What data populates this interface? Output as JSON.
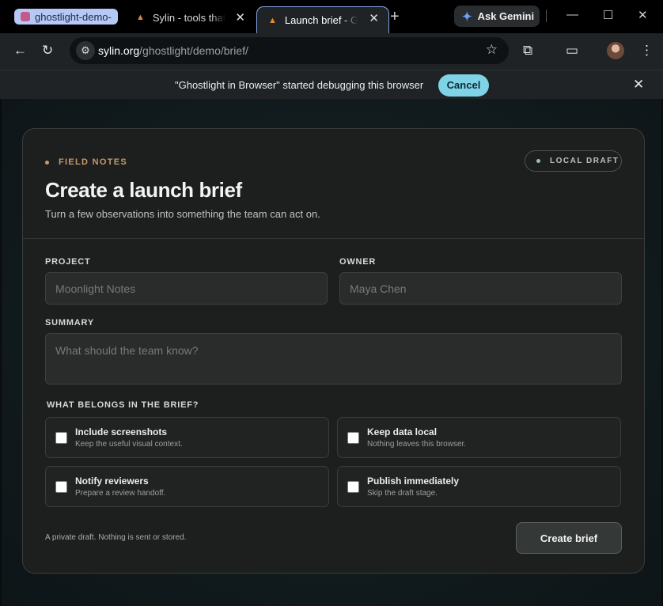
{
  "browser": {
    "tab_group_label": "ghostlight-demo-",
    "tabs": [
      {
        "label": "Sylin - tools that a"
      },
      {
        "label": "Launch brief - Gh"
      }
    ],
    "new_tab_symbol": "+",
    "gemini_label": "Ask Gemini",
    "url_host": "sylin.org",
    "url_path": "/ghostlight/demo/brief/"
  },
  "infobar": {
    "message": "\"Ghostlight in Browser\" started debugging this browser",
    "cancel_label": "Cancel"
  },
  "card": {
    "eyebrow": "FIELD NOTES",
    "status_pill": "LOCAL DRAFT",
    "title": "Create a launch brief",
    "subtitle": "Turn a few observations into something the team can act on.",
    "project": {
      "label": "PROJECT",
      "placeholder": "Moonlight Notes"
    },
    "owner": {
      "label": "OWNER",
      "placeholder": "Maya Chen"
    },
    "summary": {
      "label": "SUMMARY",
      "placeholder": "What should the team know?"
    },
    "options_heading": "WHAT BELONGS IN THE BRIEF?",
    "options": [
      {
        "title": "Include screenshots",
        "desc": "Keep the useful visual context."
      },
      {
        "title": "Keep data local",
        "desc": "Nothing leaves this browser."
      },
      {
        "title": "Notify reviewers",
        "desc": "Prepare a review handoff."
      },
      {
        "title": "Publish immediately",
        "desc": "Skip the draft stage."
      }
    ],
    "footer_note": "A private draft. Nothing is sent or stored.",
    "create_label": "Create brief"
  },
  "colors": {
    "accent_cyan": "#7fd3e6",
    "eyebrow_gold": "#c49a6c",
    "card_bg": "#1d1f1e"
  },
  "icons": [
    "back-arrow-icon",
    "reload-icon",
    "site-settings-icon",
    "bookmark-star-icon",
    "extensions-icon",
    "cast-icon",
    "menu-kebab-icon",
    "close-icon",
    "gemini-spark-icon"
  ]
}
